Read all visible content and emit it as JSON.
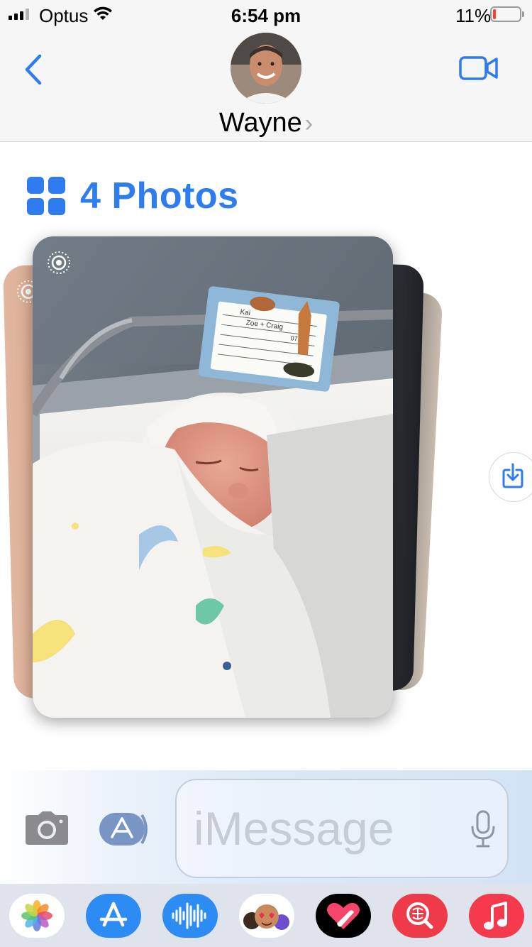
{
  "status_bar": {
    "carrier": "Optus",
    "time": "6:54 pm",
    "battery_percent": "11%",
    "battery_level": 0.11,
    "battery_color": "#ff3b30",
    "signal_bars_active": 3,
    "signal_bars_total": 4
  },
  "header": {
    "back_icon": "chevron-left-icon",
    "contact_name": "Wayne",
    "detail_chevron": "›",
    "video_icon": "video-camera-icon",
    "accent_color": "#2f7bf0"
  },
  "message": {
    "stack_title": "4 Photos",
    "stack_icon": "photo-grid-icon",
    "photo_count": 4,
    "card_note": {
      "name_line": "Kai",
      "parents_line": "Zoe + Craig",
      "time_line": "0717"
    },
    "save_icon": "save-to-photos-icon"
  },
  "compose": {
    "camera_icon": "camera-icon",
    "apps_icon": "app-store-icon",
    "placeholder": "iMessage",
    "mic_icon": "microphone-icon"
  },
  "app_drawer": {
    "apps": [
      {
        "name": "Photos",
        "icon": "photos-icon",
        "color": "#ffffff"
      },
      {
        "name": "App Store",
        "icon": "app-store-icon",
        "color": "#2d8cf4"
      },
      {
        "name": "Audio",
        "icon": "audio-waveform-icon",
        "color": "#2d8cf4"
      },
      {
        "name": "Memoji",
        "icon": "memoji-icon",
        "color": "#ffffff"
      },
      {
        "name": "Digital Touch",
        "icon": "digital-touch-icon",
        "color": "#000000"
      },
      {
        "name": "Images",
        "icon": "image-search-icon",
        "color": "#ef3a4a"
      },
      {
        "name": "Music",
        "icon": "music-icon",
        "color": "#f43a4c"
      }
    ]
  }
}
